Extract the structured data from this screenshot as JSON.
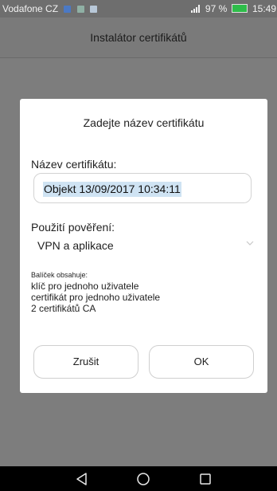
{
  "status_bar": {
    "carrier": "Vodafone CZ",
    "notification_icons": [
      "facebook-icon",
      "sms-icon",
      "image-icon"
    ],
    "battery_percent": "97 %",
    "time": "15:49"
  },
  "app_bar": {
    "title": "Instalátor certifikátů"
  },
  "dialog": {
    "title": "Zadejte název certifikátu",
    "name_label": "Název certifikátu:",
    "name_value": "Objekt 13/09/2017 10:34:11",
    "usage_label": "Použití pověření:",
    "usage_value": "VPN a aplikace",
    "package_label": "Balíček obsahuje:",
    "package_items": [
      "klíč pro jednoho uživatele",
      "certifikát pro jednoho uživatele",
      "2 certifikátů CA"
    ],
    "cancel_label": "Zrušit",
    "ok_label": "OK"
  },
  "nav_bar": {
    "icons": [
      "back-icon",
      "home-icon",
      "recents-icon"
    ]
  },
  "colors": {
    "overlay": "#7d7d7d",
    "dialog_bg": "#ffffff",
    "selection": "#cfe3f3",
    "battery": "#2ebd4a"
  }
}
